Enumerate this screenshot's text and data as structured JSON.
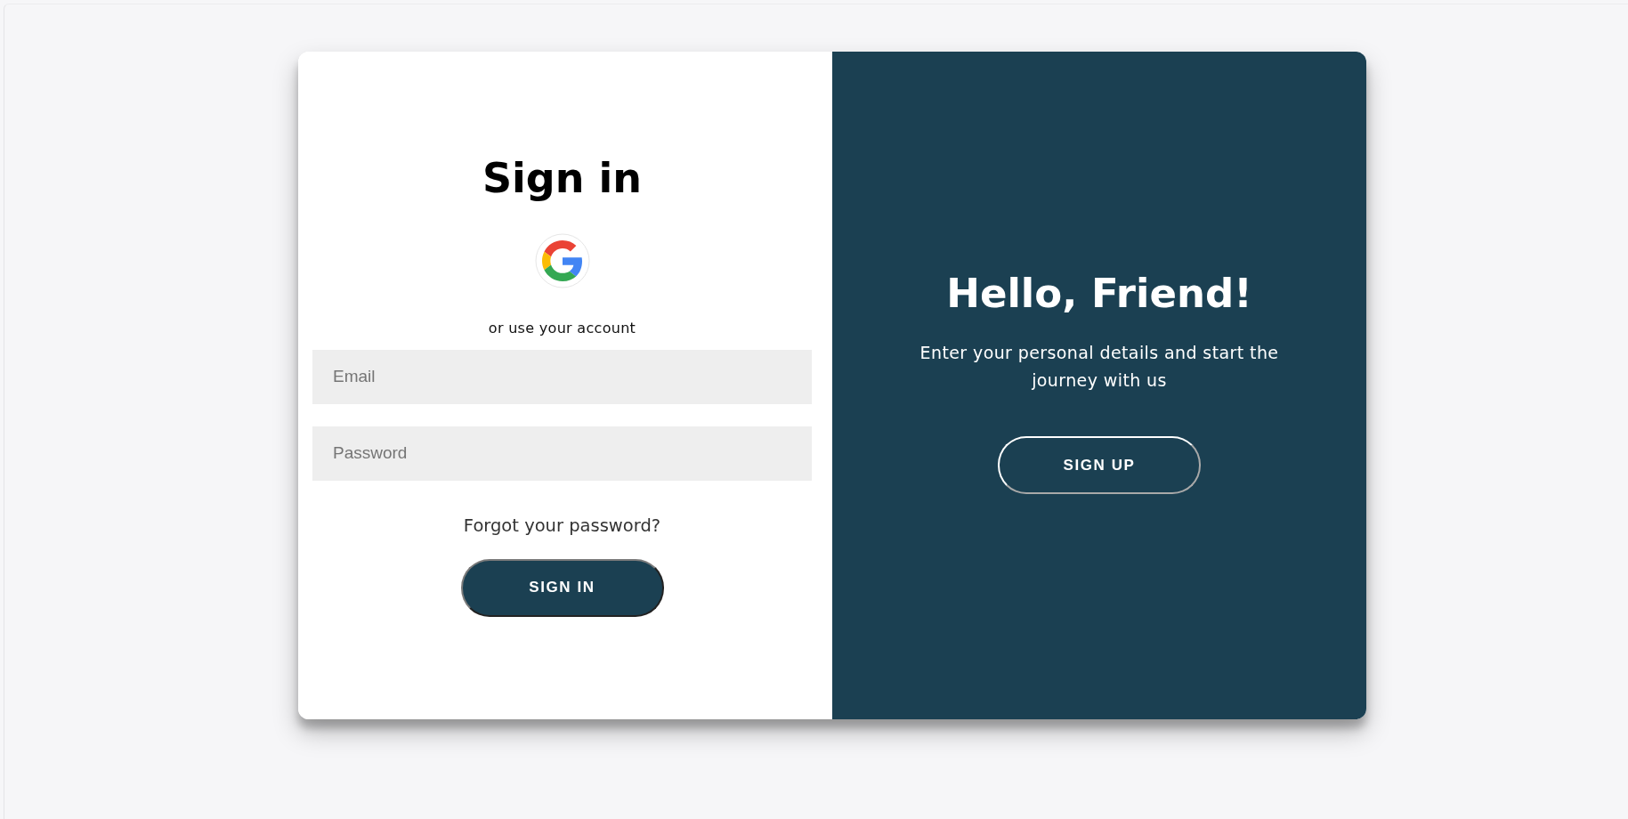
{
  "sign_in_panel": {
    "title": "Sign in",
    "social_caption": "or use your account",
    "fields": [
      {
        "placeholder": "Email"
      },
      {
        "placeholder": "Password"
      }
    ],
    "forgot_link": "Forgot your password?",
    "button": "SIGN IN"
  },
  "welcome_panel": {
    "title": "Hello, Friend!",
    "message": "Enter your personal details and start the journey with us",
    "button": "SIGN UP"
  }
}
